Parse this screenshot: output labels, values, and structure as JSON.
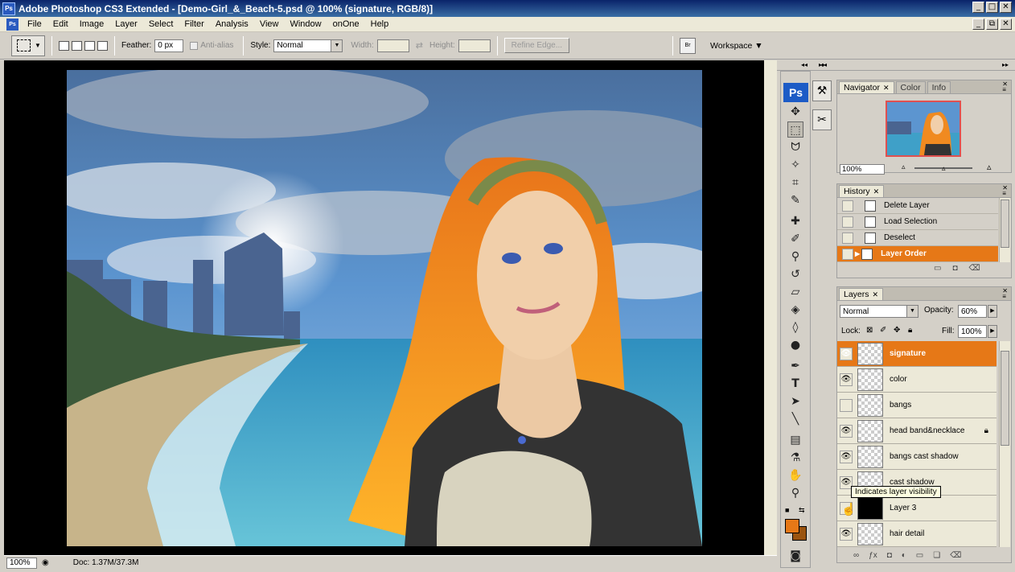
{
  "window": {
    "title": "Adobe Photoshop CS3 Extended - [Demo-Girl_&_Beach-5.psd @ 100% (signature, RGB/8)]",
    "app_icon": "Ps",
    "min": "_",
    "max": "□",
    "close": "✕",
    "doc_min": "_",
    "doc_restore": "⧉",
    "doc_close": "✕"
  },
  "menu": [
    "File",
    "Edit",
    "Image",
    "Layer",
    "Select",
    "Filter",
    "Analysis",
    "View",
    "Window",
    "onOne",
    "Help"
  ],
  "options": {
    "feather_label": "Feather:",
    "feather_value": "0 px",
    "antialias_label": "Anti-alias",
    "style_label": "Style:",
    "style_value": "Normal",
    "width_label": "Width:",
    "height_label": "Height:",
    "refine_edge": "Refine Edge...",
    "bridge_icon": "Br",
    "workspace": "Workspace ▼"
  },
  "status": {
    "zoom": "100%",
    "doc": "Doc: 1.37M/37.3M"
  },
  "toolbox": {
    "logo": "Ps"
  },
  "navigator": {
    "tabs": [
      {
        "label": "Navigator",
        "active": true
      },
      {
        "label": "Color",
        "active": false
      },
      {
        "label": "Info",
        "active": false
      }
    ],
    "zoom": "100%"
  },
  "history": {
    "tab": "History",
    "items": [
      {
        "label": "Delete Layer",
        "selected": false
      },
      {
        "label": "Load Selection",
        "selected": false
      },
      {
        "label": "Deselect",
        "selected": false
      },
      {
        "label": "Layer Order",
        "selected": true
      }
    ]
  },
  "layers": {
    "tab": "Layers",
    "blend_mode": "Normal",
    "opacity_label": "Opacity:",
    "opacity": "60%",
    "lock_label": "Lock:",
    "fill_label": "Fill:",
    "fill": "100%",
    "tooltip": "Indicates layer visibility",
    "items": [
      {
        "name": "signature",
        "visible": true,
        "selected": true,
        "thumb": "transparent",
        "locked": false
      },
      {
        "name": "color",
        "visible": true,
        "selected": false,
        "thumb": "transparent",
        "locked": false
      },
      {
        "name": "bangs",
        "visible": false,
        "selected": false,
        "thumb": "transparent",
        "locked": false
      },
      {
        "name": "head band&necklace",
        "visible": true,
        "selected": false,
        "thumb": "transparent",
        "locked": true
      },
      {
        "name": "bangs cast shadow",
        "visible": true,
        "selected": false,
        "thumb": "transparent",
        "locked": false
      },
      {
        "name": "cast shadow",
        "visible": true,
        "selected": false,
        "thumb": "transparent",
        "locked": false
      },
      {
        "name": "Layer 3",
        "visible": false,
        "selected": false,
        "thumb": "black",
        "locked": false
      },
      {
        "name": "hair detail",
        "visible": true,
        "selected": false,
        "thumb": "transparent",
        "locked": false
      }
    ]
  },
  "colors": {
    "accent": "#e67817",
    "foreground": "#e67817",
    "background": "#9a5410"
  }
}
